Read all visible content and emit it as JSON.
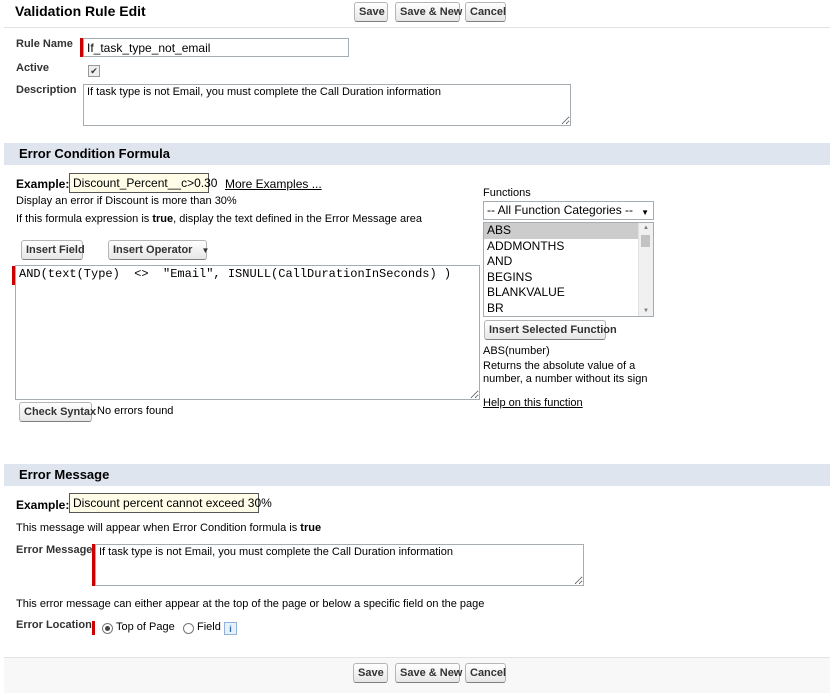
{
  "header": {
    "title": "Validation Rule Edit"
  },
  "buttons": {
    "save": "Save",
    "save_new": "Save & New",
    "cancel": "Cancel"
  },
  "rule": {
    "name_label": "Rule Name",
    "name_value": "If_task_type_not_email",
    "active_label": "Active",
    "active_checked": true,
    "description_label": "Description",
    "description_value": "If task type is not Email, you must complete the Call Duration information"
  },
  "formula": {
    "section_title": "Error Condition Formula",
    "example_label": "Example:",
    "example_value": "Discount_Percent__c>0.30",
    "more_examples": "More Examples ...",
    "example_desc": "Display an error if Discount is more than 30%",
    "hint_pre": "If this formula expression is ",
    "hint_bold": "true",
    "hint_post": ", display the text defined in the Error Message area",
    "insert_field": "Insert Field",
    "insert_operator": "Insert Operator",
    "value": "AND(text(Type)  <>  \"Email\", ISNULL(CallDurationInSeconds) )",
    "check_syntax": "Check Syntax",
    "syntax_status": "No errors found"
  },
  "functions": {
    "label": "Functions",
    "category_selected": "-- All Function Categories --",
    "items": [
      "ABS",
      "ADDMONTHS",
      "AND",
      "BEGINS",
      "BLANKVALUE",
      "BR"
    ],
    "insert_selected": "Insert Selected Function",
    "signature": "ABS(number)",
    "desc_line1": "Returns the absolute value of a",
    "desc_line2": "number, a number without its sign",
    "help_link": "Help on this function"
  },
  "error_message": {
    "section_title": "Error Message",
    "example_label": "Example:",
    "example_value": "Discount percent cannot exceed 30%",
    "note_pre": "This message will appear when Error Condition formula is ",
    "note_bold": "true",
    "label": "Error Message",
    "value": "If task type is not Email, you must complete the Call Duration information",
    "location_note": "This error message can either appear at the top of the page or below a specific field on the page",
    "location_label": "Error Location",
    "option_top": "Top of Page",
    "option_field": "Field"
  }
}
